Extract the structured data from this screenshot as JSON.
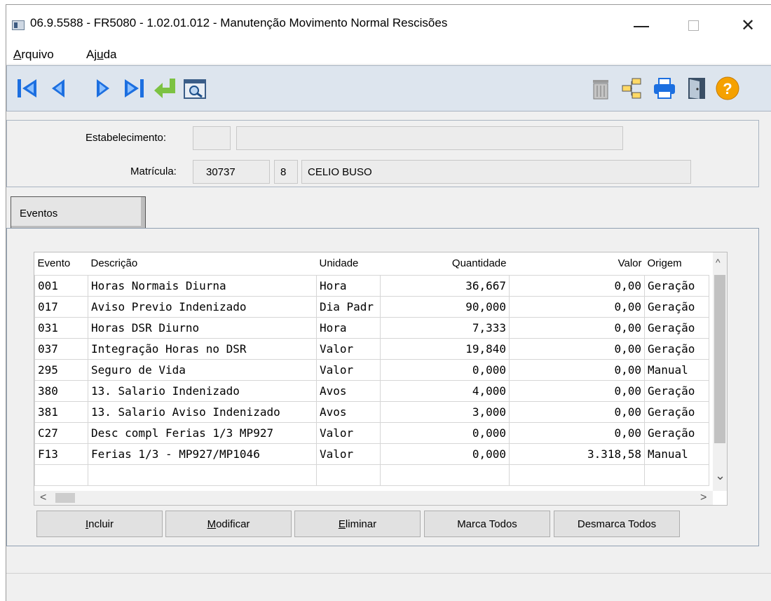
{
  "window": {
    "title": "06.9.5588 - FR5080 - 1.02.01.012 - Manutenção Movimento Normal Rescisões"
  },
  "controls": {
    "close": "✕"
  },
  "menu": {
    "arquivo": {
      "first": "A",
      "rest": "rquivo"
    },
    "ajuda": {
      "pre": "Aj",
      "ul": "u",
      "post": "da"
    }
  },
  "toolbar": {
    "icons": [
      "first-record-icon",
      "previous-record-icon",
      "next-record-icon",
      "last-record-icon",
      "goto-icon",
      "search-icon",
      "trash-icon",
      "tree-icon",
      "print-icon",
      "exit-door-icon",
      "help-icon"
    ],
    "help_label": "?",
    "colors": {
      "nav": "#1c6fe0",
      "goto": "#7cc242",
      "help": "#f5a100"
    }
  },
  "header": {
    "estabelecimento_label": "Estabelecimento:",
    "estabelecimento_code": "",
    "estabelecimento_name": "",
    "matricula_label": "Matrícula:",
    "matricula": "30737",
    "digito": "8",
    "nome": "CELIO BUSO"
  },
  "tab": {
    "label": "Eventos"
  },
  "grid": {
    "columns": [
      "Evento",
      "Descrição",
      "Unidade",
      "Quantidade",
      "Valor",
      "Origem"
    ],
    "rows": [
      [
        "001",
        "Horas Normais Diurna",
        "Hora",
        "36,667",
        "0,00",
        "Geração"
      ],
      [
        "017",
        "Aviso Previo Indenizado",
        "Dia Padr",
        "90,000",
        "0,00",
        "Geração"
      ],
      [
        "031",
        "Horas DSR Diurno",
        "Hora",
        "7,333",
        "0,00",
        "Geração"
      ],
      [
        "037",
        "Integração Horas no DSR",
        "Valor",
        "19,840",
        "0,00",
        "Geração"
      ],
      [
        "295",
        "Seguro de Vida",
        "Valor",
        "0,000",
        "0,00",
        "Manual"
      ],
      [
        "380",
        "13. Salario Indenizado",
        "Avos",
        "4,000",
        "0,00",
        "Geração"
      ],
      [
        "381",
        "13. Salario Aviso Indenizado",
        "Avos",
        "3,000",
        "0,00",
        "Geração"
      ],
      [
        "C27",
        "Desc compl Ferias 1/3 MP927",
        "Valor",
        "0,000",
        "0,00",
        "Geração"
      ],
      [
        "F13",
        "Ferias 1/3 - MP927/MP1046",
        "Valor",
        "0,000",
        "3.318,58",
        "Manual"
      ],
      [
        "",
        "",
        "",
        "",
        "",
        ""
      ]
    ],
    "selected_row": 8,
    "scroll": {
      "up": "^",
      "down": "⌄",
      "left": "<",
      "right": ">"
    }
  },
  "buttons": {
    "incluir": {
      "ul": "I",
      "rest": "ncluir"
    },
    "modificar": {
      "ul": "M",
      "rest": "odificar"
    },
    "eliminar": {
      "ul": "E",
      "rest": "liminar"
    },
    "marca_todos": "Marca Todos",
    "desmarca_todos": "Desmarca Todos"
  }
}
